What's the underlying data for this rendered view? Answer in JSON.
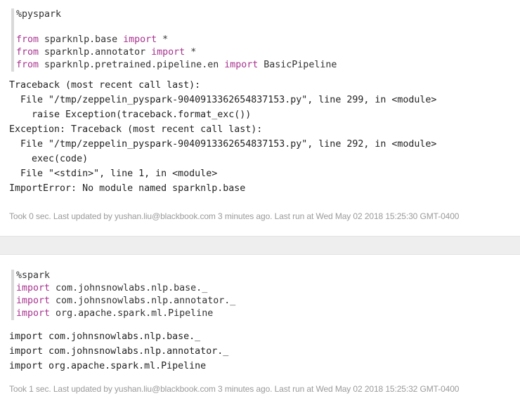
{
  "paragraphs": [
    {
      "code": [
        {
          "plain": "%pyspark",
          "kw": ""
        },
        {
          "plain": "",
          "kw": ""
        },
        {
          "kw": "from",
          "rest": " sparknlp.base ",
          "kw2": "import",
          "rest2": " *"
        },
        {
          "kw": "from",
          "rest": " sparknlp.annotator ",
          "kw2": "import",
          "rest2": " *"
        },
        {
          "kw": "from",
          "rest": " sparknlp.pretrained.pipeline.en ",
          "kw2": "import",
          "rest2": " BasicPipeline"
        }
      ],
      "output": [
        "Traceback (most recent call last):",
        "  File \"/tmp/zeppelin_pyspark-9040913362654837153.py\", line 299, in <module>",
        "    raise Exception(traceback.format_exc())",
        "Exception: Traceback (most recent call last):",
        "  File \"/tmp/zeppelin_pyspark-9040913362654837153.py\", line 292, in <module>",
        "    exec(code)",
        "  File \"<stdin>\", line 1, in <module>",
        "ImportError: No module named sparknlp.base"
      ],
      "footer": "Took 0 sec. Last updated by yushan.liu@blackbook.com 3 minutes ago. Last run at Wed May 02 2018 15:25:30 GMT-0400"
    },
    {
      "code": [
        {
          "plain": "%spark"
        },
        {
          "kw": "import",
          "rest": " com.johnsnowlabs.nlp.base._"
        },
        {
          "kw": "import",
          "rest": " com.johnsnowlabs.nlp.annotator._"
        },
        {
          "kw": "import",
          "rest": " org.apache.spark.ml.Pipeline"
        }
      ],
      "output": [
        "import com.johnsnowlabs.nlp.base._",
        "import com.johnsnowlabs.nlp.annotator._",
        "import org.apache.spark.ml.Pipeline"
      ],
      "footer": "Took 1 sec. Last updated by yushan.liu@blackbook.com 3 minutes ago. Last run at Wed May 02 2018 15:25:32 GMT-0400"
    }
  ],
  "colors": {
    "keyword": "#a8338f",
    "footer": "#9a9a9a",
    "separator": "#eeeeee"
  }
}
